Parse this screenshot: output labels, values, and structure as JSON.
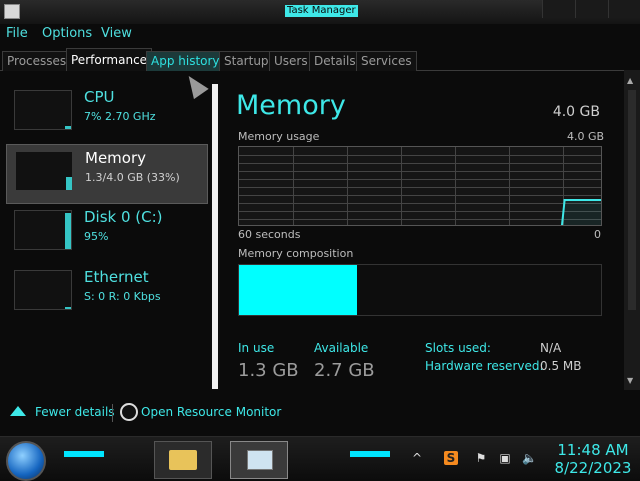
{
  "window": {
    "title": "Task Manager"
  },
  "menu": [
    "File",
    "Options",
    "View"
  ],
  "tabs": [
    "Processes",
    "Performance",
    "App history",
    "Startup",
    "Users",
    "Details",
    "Services"
  ],
  "sidebar": [
    {
      "name": "CPU",
      "sub": "7% 2.70 GHz",
      "usage": 0.07
    },
    {
      "name": "Memory",
      "sub": "1.3/4.0 GB (33%)",
      "usage": 0.33
    },
    {
      "name": "Disk 0 (C:)",
      "sub": "95%",
      "usage": 0.95
    },
    {
      "name": "Ethernet",
      "sub": "S: 0 R: 0 Kbps",
      "usage": 0.0
    }
  ],
  "detail": {
    "title": "Memory",
    "total": "4.0 GB",
    "usage_label": "Memory usage",
    "usage_max": "4.0 GB",
    "axis_left": "60 seconds",
    "axis_right": "0",
    "composition_label": "Memory composition",
    "composition_in_use_fraction": 0.325,
    "stats": {
      "in_use_label": "In use",
      "in_use_value": "1.3 GB",
      "available_label": "Available",
      "available_value": "2.7 GB",
      "slots_label": "Slots used:",
      "slots_value": "N/A",
      "hw_reserved_label": "Hardware reserved:",
      "hw_reserved_value": "0.5 MB"
    }
  },
  "footer": {
    "fewer_details": "Fewer details",
    "open_resource_monitor": "Open Resource Monitor"
  },
  "taskbar": {
    "time": "11:48 AM",
    "date": "8/22/2023",
    "tray_sublime": "S"
  },
  "colors": {
    "accent": "#3ee8e8",
    "composition_fill": "#00ffff"
  }
}
